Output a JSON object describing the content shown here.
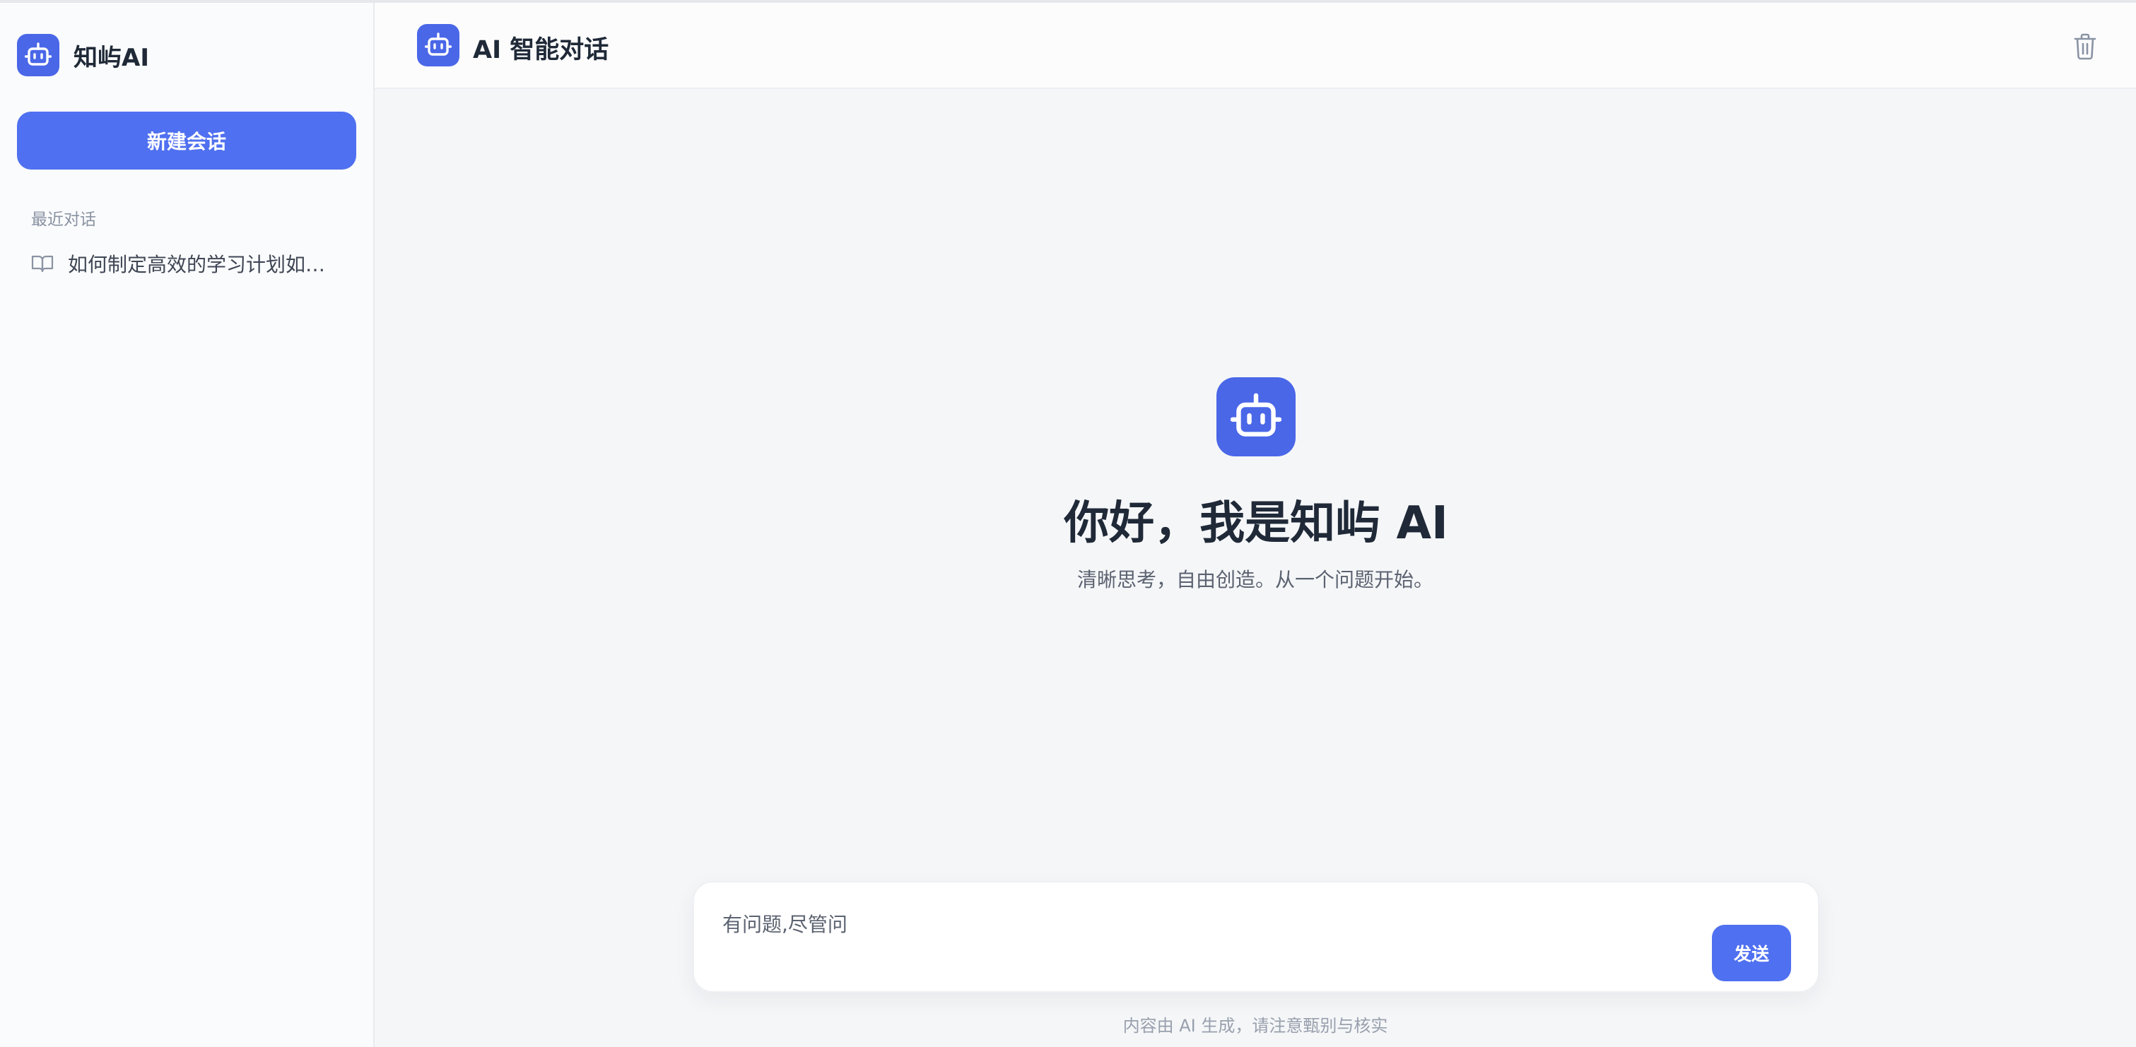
{
  "brand": {
    "name": "知屿AI",
    "accent_color": "#4f70f0",
    "logo_icon": "robot-icon"
  },
  "sidebar": {
    "new_chat_label": "新建会话",
    "recent_label": "最近对话",
    "conversations": [
      {
        "title": "如何制定高效的学习计划如何制定高效的学习计划",
        "icon": "book-open-icon"
      }
    ]
  },
  "header": {
    "title": "AI 智能对话",
    "trash_icon": "trash-icon"
  },
  "welcome": {
    "title": "你好，我是知屿 AI",
    "subtitle": "清晰思考，自由创造。从一个问题开始。"
  },
  "composer": {
    "placeholder": "有问题,尽管问",
    "value": "",
    "send_label": "发送"
  },
  "footer": {
    "disclaimer": "内容由 AI 生成，请注意甄别与核实"
  }
}
